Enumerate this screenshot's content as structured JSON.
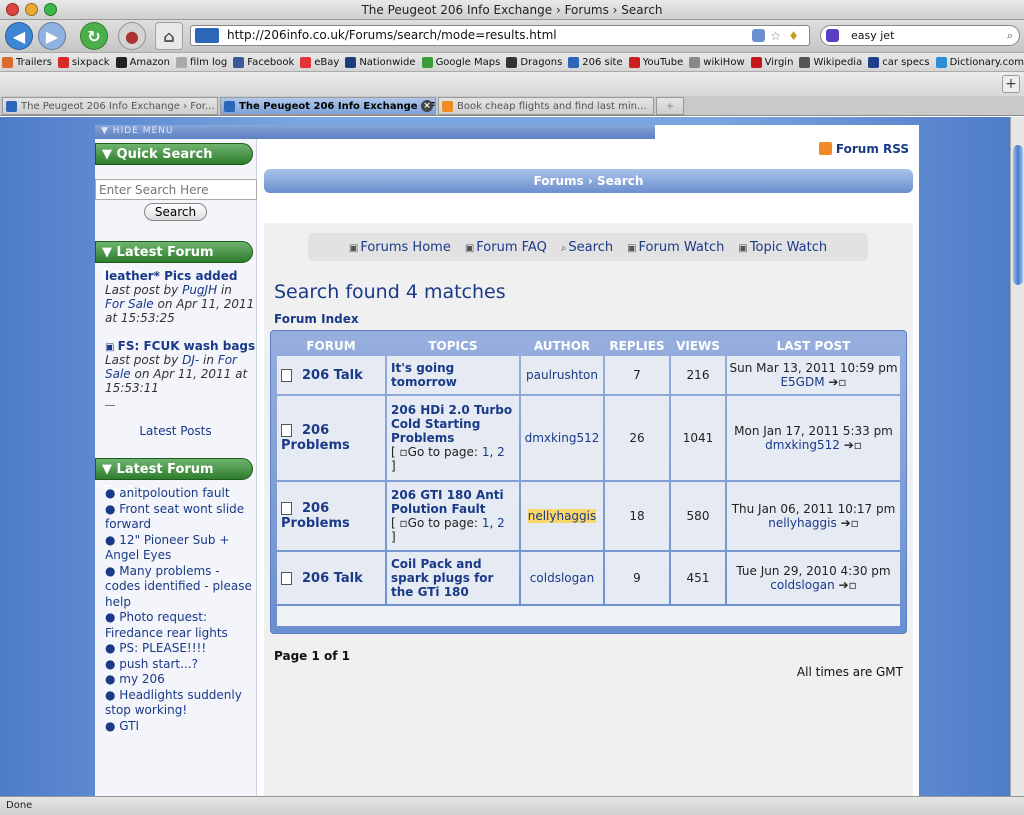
{
  "window": {
    "title": "The Peugeot 206 Info Exchange › Forums › Search"
  },
  "browser": {
    "url": "http://206info.co.uk/Forums/search/mode=results.html",
    "search_value": "easy jet",
    "bookmarks": [
      "Trailers",
      "sixpack",
      "Amazon",
      "film log",
      "Facebook",
      "eBay",
      "Nationwide",
      "Google Maps",
      "Dragons",
      "206 site",
      "YouTube",
      "wikiHow",
      "Virgin",
      "Wikipedia",
      "car specs",
      "Dictionary.com"
    ],
    "tabs": [
      "The Peugeot 206 Info Exchange › For...",
      "The Peugeot 206 Info Exchange › F...",
      "Book cheap flights and find last min..."
    ],
    "status": "Done"
  },
  "sidebar": {
    "hide_menu": "HIDE MENU",
    "quick_search": {
      "heading": "Quick Search",
      "placeholder": "Enter Search Here",
      "button": "Search"
    },
    "latest_posts": {
      "heading": "Latest Forum Posts",
      "posts": [
        {
          "title": "leather* Pics added",
          "prefix": "Last post by",
          "user": "PugJH",
          "in": "in",
          "forum": "For Sale",
          "when": "on Apr 11, 2011 at 15:53:25"
        },
        {
          "title": "FS: FCUK wash bags",
          "prefix": "Last post by",
          "user": "DJ-",
          "in": "in",
          "forum": "For Sale",
          "when": "on Apr 11, 2011 at 15:53:11"
        }
      ],
      "more_link": "Latest Posts"
    },
    "latest_topics": {
      "heading": "Latest Forum Topics",
      "items": [
        "anitpoloution fault",
        "Front seat wont slide forward",
        "12\" Pioneer Sub + Angel Eyes",
        "Many problems - codes identified - please help",
        "Photo request: Firedance rear lights",
        "PS: PLEASE!!!!",
        "push start...?",
        "my 206",
        "Headlights suddenly stop working!",
        "GTI"
      ]
    }
  },
  "main": {
    "rss": "Forum RSS",
    "breadcrumb": "Forums › Search",
    "quick_links": [
      "Forums Home",
      "Forum FAQ",
      "Search",
      "Forum Watch",
      "Topic Watch"
    ],
    "heading": "Search found 4 matches",
    "forum_index": "Forum Index",
    "columns": [
      "FORUM",
      "TOPICS",
      "AUTHOR",
      "REPLIES",
      "VIEWS",
      "LAST POST"
    ],
    "rows": [
      {
        "forum": "206 Talk",
        "topic": "It's going tomorrow",
        "goto": "",
        "pages": [],
        "author": "paulrushton",
        "replies": "7",
        "views": "216",
        "last_date": "Sun Mar 13, 2011 10:59 pm",
        "last_user": "E5GDM"
      },
      {
        "forum": "206 Problems",
        "topic": "206 HDi 2.0 Turbo Cold Starting Problems",
        "goto": "Go to page:",
        "pages": [
          "1",
          "2"
        ],
        "author": "dmxking512",
        "replies": "26",
        "views": "1041",
        "last_date": "Mon Jan 17, 2011 5:33 pm",
        "last_user": "dmxking512"
      },
      {
        "forum": "206 Problems",
        "topic": "206 GTI 180 Anti Polution Fault",
        "goto": "Go to page:",
        "pages": [
          "1",
          "2"
        ],
        "author": "nellyhaggis",
        "replies": "18",
        "views": "580",
        "last_date": "Thu Jan 06, 2011 10:17 pm",
        "last_user": "nellyhaggis"
      },
      {
        "forum": "206 Talk",
        "topic": "Coil Pack and spark plugs for the GTi 180",
        "goto": "",
        "pages": [],
        "author": "coldslogan",
        "replies": "9",
        "views": "451",
        "last_date": "Tue Jun 29, 2010 4:30 pm",
        "last_user": "coldslogan"
      }
    ],
    "page_count": "Page 1 of 1",
    "timezone": "All times are GMT"
  }
}
